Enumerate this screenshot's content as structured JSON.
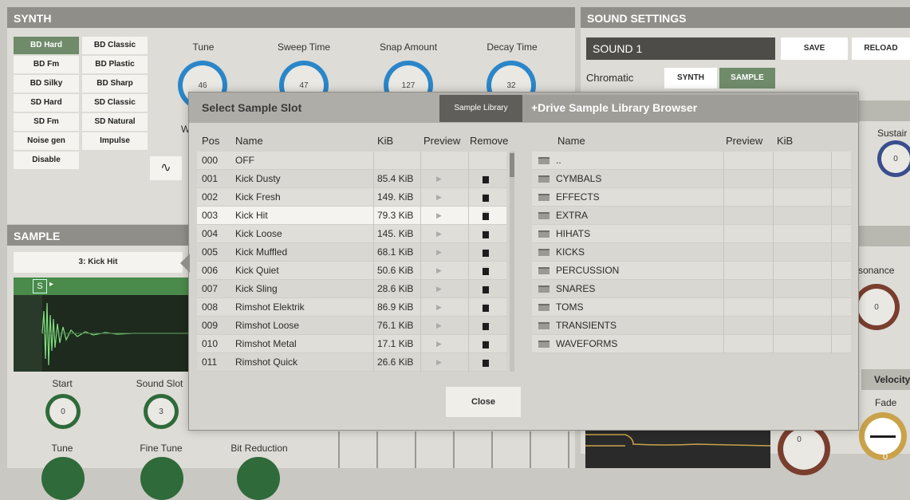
{
  "synth": {
    "title": "SYNTH",
    "buttons": [
      "BD Hard",
      "BD Classic",
      "BD Fm",
      "BD Plastic",
      "BD Silky",
      "BD Sharp",
      "SD Hard",
      "SD Classic",
      "SD Fm",
      "SD Natural",
      "Noise gen",
      "Impulse",
      "Disable"
    ],
    "active": "BD Hard",
    "knobs": [
      {
        "label": "Tune",
        "value": "46"
      },
      {
        "label": "Sweep Time",
        "value": "47"
      },
      {
        "label": "Snap Amount",
        "value": "127"
      },
      {
        "label": "Decay Time",
        "value": "32"
      }
    ],
    "partial_label": "W"
  },
  "sound_settings": {
    "title": "SOUND SETTINGS",
    "sound_name": "SOUND 1",
    "save": "SAVE",
    "reload": "RELOAD",
    "chromatic": "Chromatic",
    "synth_tab": "SYNTH",
    "sample_tab": "SAMPLE",
    "sustain": "Sustair",
    "sustain_value": "0",
    "resonance": "sonance",
    "resonance_value": "0",
    "velocity": "Velocity",
    "fade": "Fade",
    "knob_b_value": "0",
    "knob_c_value": "0"
  },
  "sample": {
    "title": "SAMPLE",
    "slot_name": "3: Kick Hit",
    "slot_badge": "S",
    "start_label": "Start",
    "start_value": "0",
    "sound_slot_label": "Sound Slot",
    "sound_slot_value": "3",
    "tune_label": "Tune",
    "fine_tune_label": "Fine Tune",
    "bit_reduction_label": "Bit Reduction"
  },
  "dialog": {
    "title": "Select Sample Slot",
    "library_tab": "Sample Library",
    "drive_title": "+Drive Sample Library Browser",
    "close": "Close",
    "slot_headers": {
      "pos": "Pos",
      "name": "Name",
      "kib": "KiB",
      "preview": "Preview",
      "remove": "Remove"
    },
    "slots": [
      {
        "pos": "000",
        "name": "OFF",
        "kib": ""
      },
      {
        "pos": "001",
        "name": "Kick Dusty",
        "kib": "85.4 KiB"
      },
      {
        "pos": "002",
        "name": "Kick Fresh",
        "kib": "149. KiB"
      },
      {
        "pos": "003",
        "name": "Kick Hit",
        "kib": "79.3 KiB"
      },
      {
        "pos": "004",
        "name": "Kick Loose",
        "kib": "145. KiB"
      },
      {
        "pos": "005",
        "name": "Kick Muffled",
        "kib": "68.1 KiB"
      },
      {
        "pos": "006",
        "name": "Kick Quiet",
        "kib": "50.6 KiB"
      },
      {
        "pos": "007",
        "name": "Kick Sling",
        "kib": "28.6 KiB"
      },
      {
        "pos": "008",
        "name": "Rimshot Elektrik",
        "kib": "86.9 KiB"
      },
      {
        "pos": "009",
        "name": "Rimshot Loose",
        "kib": "76.1 KiB"
      },
      {
        "pos": "010",
        "name": "Rimshot Metal",
        "kib": "17.1 KiB"
      },
      {
        "pos": "011",
        "name": "Rimshot Quick",
        "kib": "26.6 KiB"
      }
    ],
    "selected_pos": "003",
    "lib_headers": {
      "name": "Name",
      "preview": "Preview",
      "kib": "KiB"
    },
    "folders": [
      "..",
      "CYMBALS",
      "EFFECTS",
      "EXTRA",
      "HIHATS",
      "KICKS",
      "PERCUSSION",
      "SNARES",
      "TOMS",
      "TRANSIENTS",
      "WAVEFORMS"
    ]
  }
}
